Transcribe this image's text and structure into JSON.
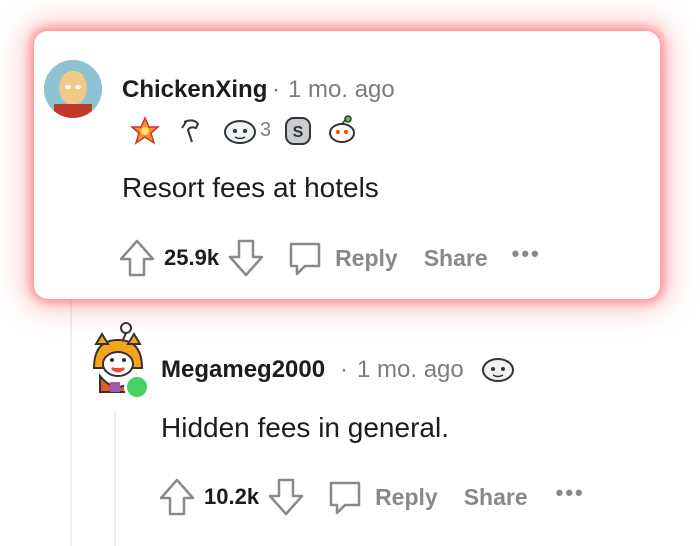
{
  "comments": [
    {
      "username": "ChickenXing",
      "separator": "·",
      "time": "1 mo. ago",
      "award_count": "3",
      "text": "Resort fees at hotels",
      "score": "25.9k",
      "reply_label": "Reply",
      "share_label": "Share",
      "more_label": "•••"
    },
    {
      "username": "Megameg2000",
      "separator": "·",
      "time": "1 mo. ago",
      "text": "Hidden fees in general.",
      "score": "10.2k",
      "reply_label": "Reply",
      "share_label": "Share",
      "more_label": "•••"
    }
  ],
  "colors": {
    "highlight_glow": "#ff5a5a",
    "meta_gray": "#7c7c7c",
    "action_gray": "#878a8c",
    "online_dot": "#46d160"
  },
  "icons": [
    "upvote-icon",
    "downvote-icon",
    "comment-bubble-icon",
    "more-options-icon",
    "award-icon",
    "online-indicator-icon"
  ]
}
